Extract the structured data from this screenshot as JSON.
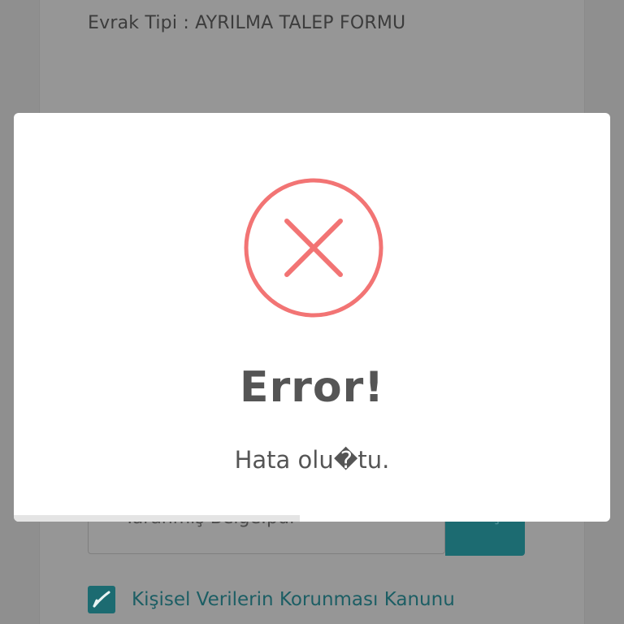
{
  "page": {
    "doc_type_label": "Evrak Tipi : AYRILMA TALEP FORMU",
    "file_input_value": "Taranmış Belge.pdf",
    "choose_button_label": "Seç",
    "consent_label": "Kişisel Verilerin Korunması Kanunu",
    "consent_checked": true
  },
  "modal": {
    "icon": "error-x-circle-icon",
    "title": "Error!",
    "message": "Hata olu�tu.",
    "progress_fraction": 0.48
  },
  "colors": {
    "error_red": "#f27474",
    "teal": "#1c6b71",
    "overlay": "#8f8f8f"
  }
}
